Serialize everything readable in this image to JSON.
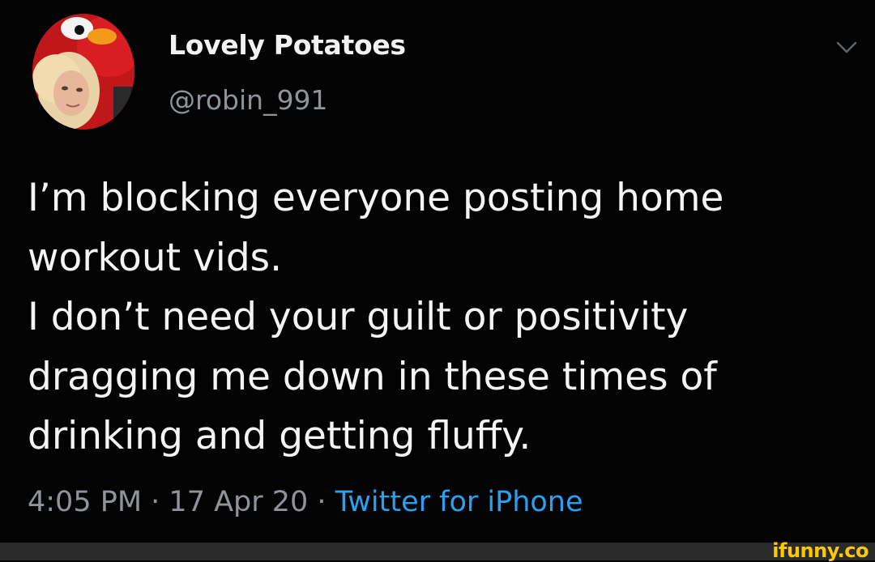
{
  "tweet": {
    "display_name": "Lovely Potatoes",
    "handle": "@robin_991",
    "text_lines": [
      "I’m blocking everyone posting home",
      "workout vids.",
      "I don’t need your guilt or positivity",
      "dragging me down in these times of",
      "drinking and getting fluffy."
    ],
    "time": "4:05 PM",
    "separator": " · ",
    "date": "17 Apr 20",
    "source": "Twitter for iPhone",
    "menu_icon": "chevron-down-icon",
    "avatar_icon": "profile-avatar"
  },
  "watermark": {
    "text": "ifunny.co"
  },
  "colors": {
    "background": "#030303",
    "text": "#f4f4f4",
    "secondary_text": "#8e9499",
    "link": "#2aa0f0",
    "watermark": "#ffc900"
  }
}
